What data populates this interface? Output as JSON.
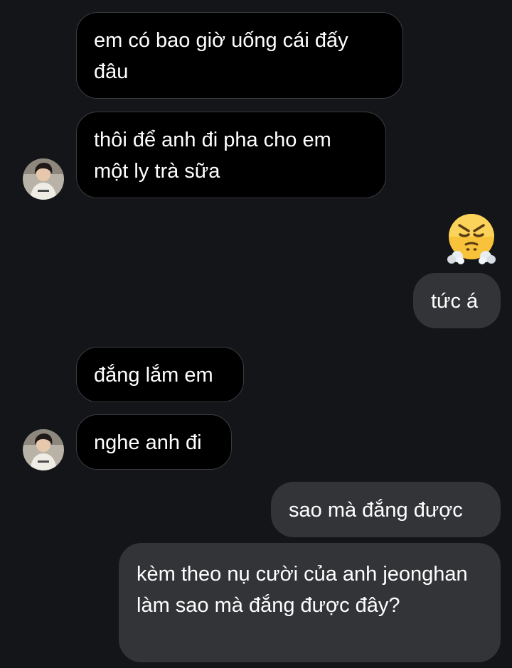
{
  "conversation": {
    "messages": [
      {
        "sender": "contact",
        "text": "em có bao giờ uống cái đấy đâu"
      },
      {
        "sender": "contact",
        "text": "thôi để anh đi pha cho em một ly trà sữa"
      },
      {
        "sender": "me",
        "text": "😤",
        "emoji_name": "face-with-steam-from-nose"
      },
      {
        "sender": "me",
        "text": "tức á"
      },
      {
        "sender": "contact",
        "text": "đắng lắm em"
      },
      {
        "sender": "contact",
        "text": "nghe anh đi"
      },
      {
        "sender": "me",
        "text": "sao mà đắng được"
      },
      {
        "sender": "me",
        "text": "kèm theo nụ cười của anh jeonghan làm sao mà đắng được đây?"
      }
    ]
  },
  "theme": {
    "background": "#131518",
    "incoming_bubble": "#000000",
    "incoming_border": "#3a3c40",
    "outgoing_bubble": "#333437",
    "text": "#ffffff"
  }
}
